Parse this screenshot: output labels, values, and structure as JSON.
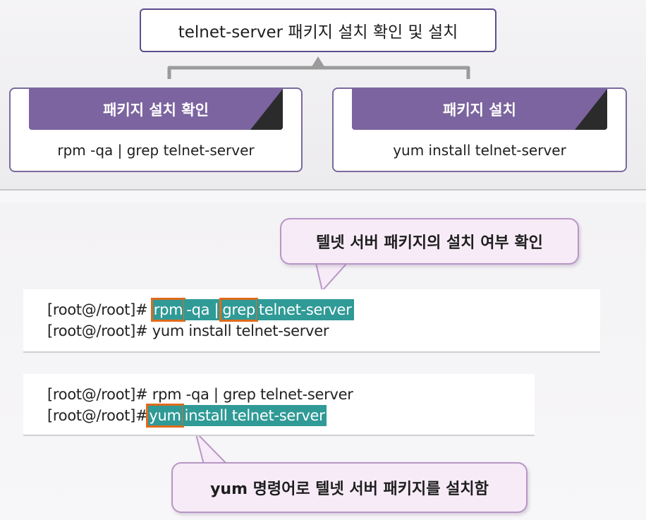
{
  "title": "telnet-server 패키지 설치 확인 및 설치",
  "panels": [
    {
      "heading": "패키지 설치 확인",
      "command": "rpm -qa | grep telnet-server"
    },
    {
      "heading": "패키지 설치",
      "command": "yum install telnet-server"
    }
  ],
  "terminal1": {
    "prompt": "[root@/root]#",
    "line1": {
      "rpm": "rpm",
      "qa": "-qa |",
      "grep": "grep",
      "rest": "telnet-server"
    },
    "line2": "yum install telnet-server"
  },
  "terminal2": {
    "prompt": "[root@/root]#",
    "line1": "rpm -qa | grep telnet-server",
    "line2": {
      "yum": "yum",
      "rest": "install telnet-server"
    }
  },
  "callouts": {
    "check": "텔넷 서버 패키지의 설치 여부 확인",
    "install": "yum 명령어로 텔넷 서버 패키지를 설치함"
  },
  "colors": {
    "accent": "#7b649f",
    "highlight": "#2f9a96",
    "box_outline": "#e06b1b",
    "bubble": "#f6ebf6"
  }
}
